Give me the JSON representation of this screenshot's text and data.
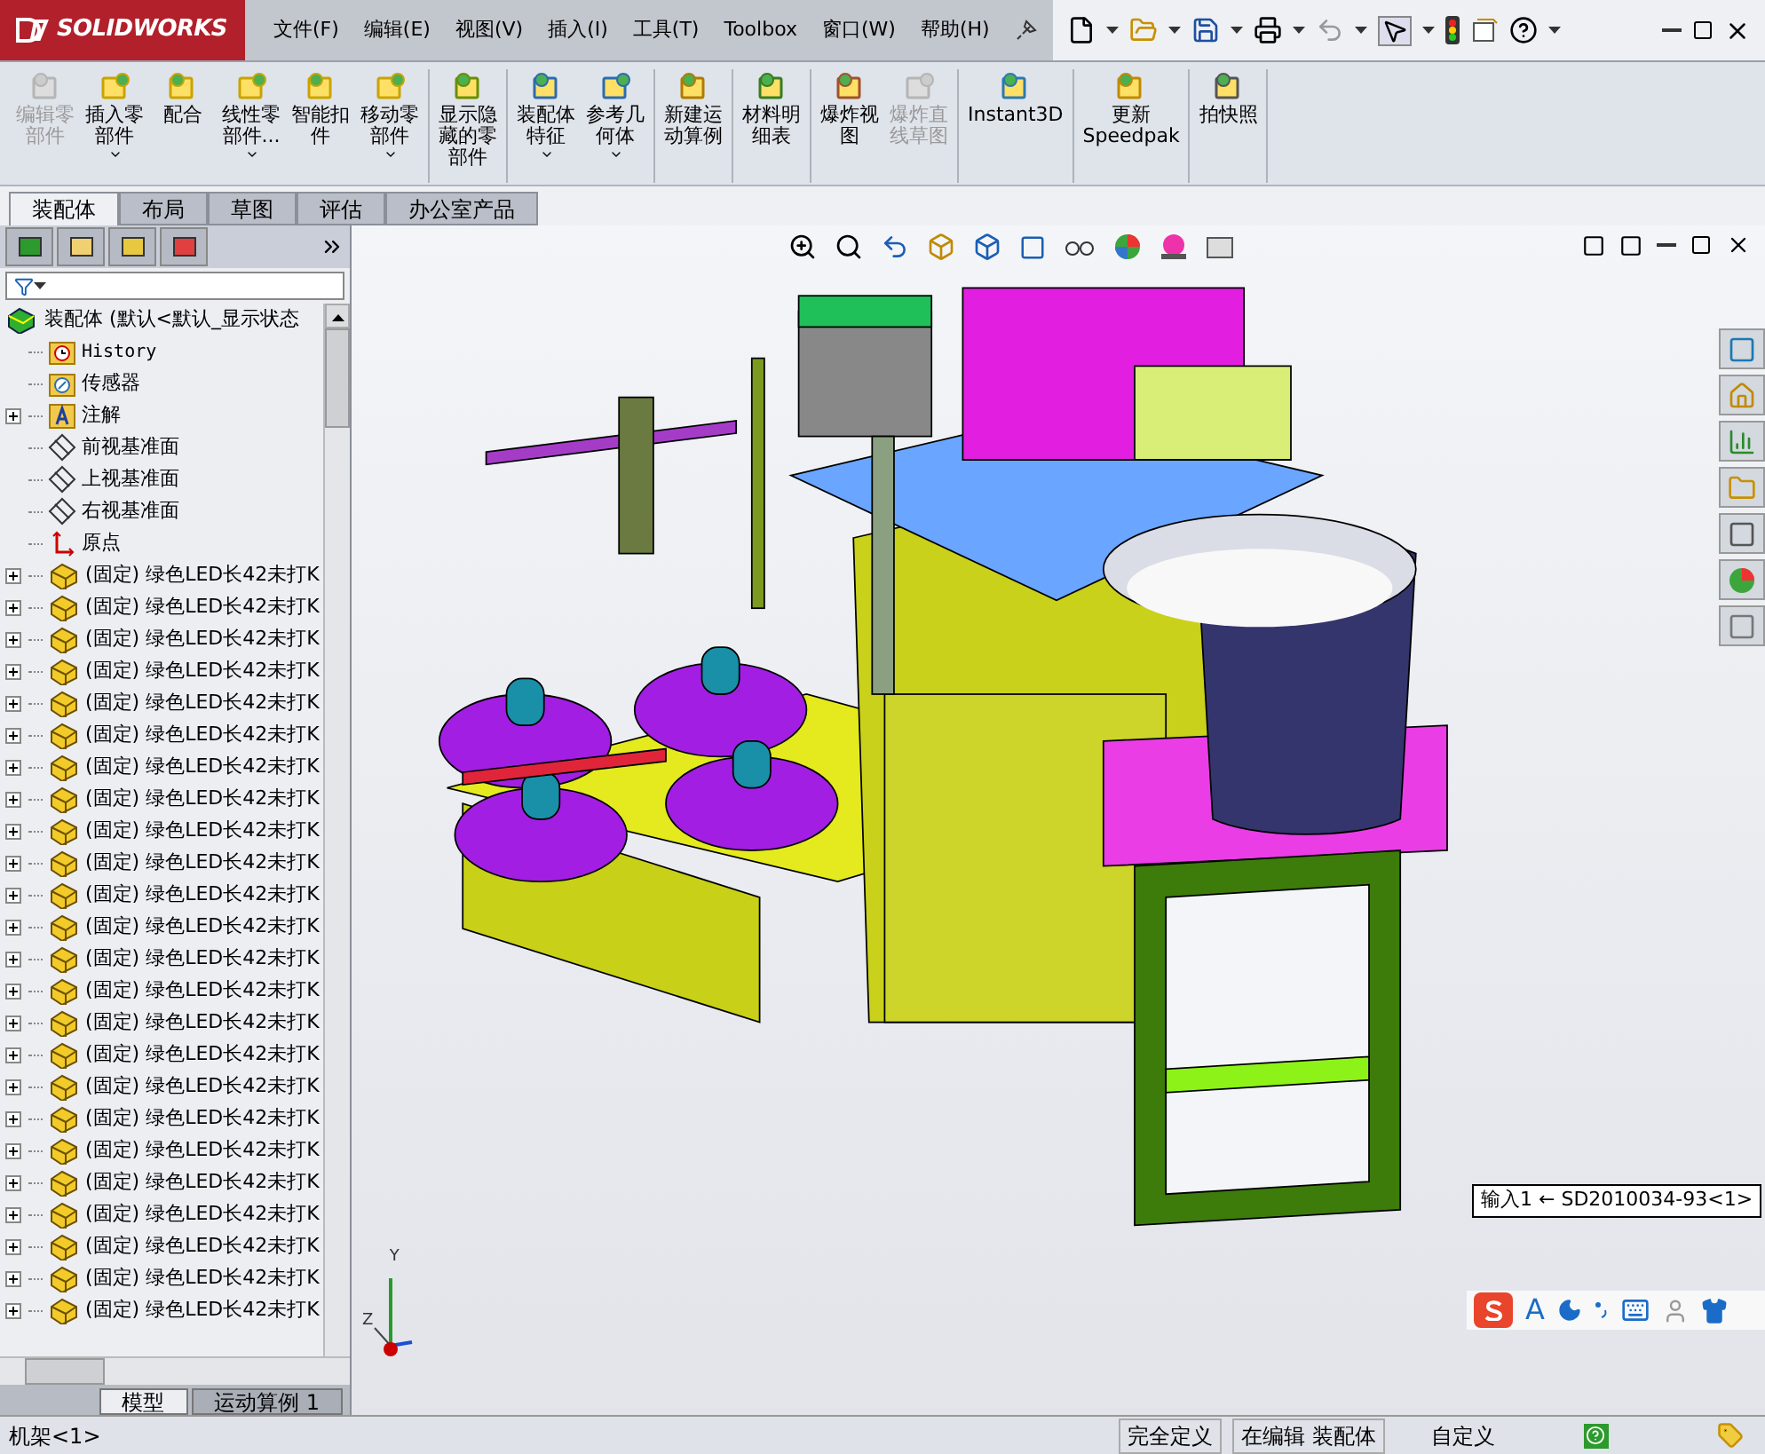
{
  "app": {
    "logo_text": "SOLIDWORKS"
  },
  "menu": [
    "文件(F)",
    "编辑(E)",
    "视图(V)",
    "插入(I)",
    "工具(T)",
    "Toolbox",
    "窗口(W)",
    "帮助(H)"
  ],
  "ribbon": {
    "groups": [
      [
        {
          "lines": [
            "编辑零",
            "部件"
          ],
          "disabled": true,
          "dropdown": false
        },
        {
          "lines": [
            "插入零",
            "部件"
          ],
          "disabled": false,
          "dropdown": true
        },
        {
          "lines": [
            "配合"
          ],
          "disabled": false,
          "dropdown": false
        },
        {
          "lines": [
            "线性零",
            "部件..."
          ],
          "disabled": false,
          "dropdown": true
        },
        {
          "lines": [
            "智能扣",
            "件"
          ],
          "disabled": false,
          "dropdown": false
        },
        {
          "lines": [
            "移动零",
            "部件"
          ],
          "disabled": false,
          "dropdown": true
        }
      ],
      [
        {
          "lines": [
            "显示隐",
            "藏的零",
            "部件"
          ],
          "disabled": false,
          "dropdown": false
        }
      ],
      [
        {
          "lines": [
            "装配体",
            "特征"
          ],
          "disabled": false,
          "dropdown": true
        },
        {
          "lines": [
            "参考几",
            "何体"
          ],
          "disabled": false,
          "dropdown": true
        }
      ],
      [
        {
          "lines": [
            "新建运",
            "动算例"
          ],
          "disabled": false,
          "dropdown": false
        }
      ],
      [
        {
          "lines": [
            "材料明",
            "细表"
          ],
          "disabled": false,
          "dropdown": false
        }
      ],
      [
        {
          "lines": [
            "爆炸视",
            "图"
          ],
          "disabled": false,
          "dropdown": false
        },
        {
          "lines": [
            "爆炸直",
            "线草图"
          ],
          "disabled": true,
          "dropdown": false
        }
      ],
      [
        {
          "lines": [
            "Instant3D"
          ],
          "disabled": false,
          "dropdown": false
        }
      ],
      [
        {
          "lines": [
            "更新",
            "Speedpak"
          ],
          "disabled": false,
          "dropdown": false
        }
      ],
      [
        {
          "lines": [
            "拍快照"
          ],
          "disabled": false,
          "dropdown": false
        }
      ]
    ]
  },
  "tabs": [
    {
      "label": "装配体",
      "selected": true
    },
    {
      "label": "布局",
      "selected": false
    },
    {
      "label": "草图",
      "selected": false
    },
    {
      "label": "评估",
      "selected": false
    },
    {
      "label": "办公室产品",
      "selected": false
    }
  ],
  "tree": {
    "root": "装配体 (默认<默认_显示状态",
    "items": [
      {
        "label": "History",
        "kind": "history",
        "expandable": false
      },
      {
        "label": "传感器",
        "kind": "sensor",
        "expandable": false
      },
      {
        "label": "注解",
        "kind": "annotation",
        "expandable": true
      },
      {
        "label": "前视基准面",
        "kind": "plane",
        "expandable": false
      },
      {
        "label": "上视基准面",
        "kind": "plane",
        "expandable": false
      },
      {
        "label": "右视基准面",
        "kind": "plane",
        "expandable": false
      },
      {
        "label": "原点",
        "kind": "origin",
        "expandable": false
      },
      {
        "label": "(固定) 绿色LED长42未打K",
        "kind": "part",
        "expandable": true
      },
      {
        "label": "(固定) 绿色LED长42未打K",
        "kind": "part",
        "expandable": true
      },
      {
        "label": "(固定) 绿色LED长42未打K",
        "kind": "part",
        "expandable": true
      },
      {
        "label": "(固定) 绿色LED长42未打K",
        "kind": "part",
        "expandable": true
      },
      {
        "label": "(固定) 绿色LED长42未打K",
        "kind": "part",
        "expandable": true
      },
      {
        "label": "(固定) 绿色LED长42未打K",
        "kind": "part",
        "expandable": true
      },
      {
        "label": "(固定) 绿色LED长42未打K",
        "kind": "part",
        "expandable": true
      },
      {
        "label": "(固定) 绿色LED长42未打K",
        "kind": "part",
        "expandable": true
      },
      {
        "label": "(固定) 绿色LED长42未打K",
        "kind": "part",
        "expandable": true
      },
      {
        "label": "(固定) 绿色LED长42未打K",
        "kind": "part",
        "expandable": true
      },
      {
        "label": "(固定) 绿色LED长42未打K",
        "kind": "part",
        "expandable": true
      },
      {
        "label": "(固定) 绿色LED长42未打K",
        "kind": "part",
        "expandable": true
      },
      {
        "label": "(固定) 绿色LED长42未打K",
        "kind": "part",
        "expandable": true
      },
      {
        "label": "(固定) 绿色LED长42未打K",
        "kind": "part",
        "expandable": true
      },
      {
        "label": "(固定) 绿色LED长42未打K",
        "kind": "part",
        "expandable": true
      },
      {
        "label": "(固定) 绿色LED长42未打K",
        "kind": "part",
        "expandable": true
      },
      {
        "label": "(固定) 绿色LED长42未打K",
        "kind": "part",
        "expandable": true
      },
      {
        "label": "(固定) 绿色LED长42未打K",
        "kind": "part",
        "expandable": true
      },
      {
        "label": "(固定) 绿色LED长42未打K",
        "kind": "part",
        "expandable": true
      },
      {
        "label": "(固定) 绿色LED长42未打K",
        "kind": "part",
        "expandable": true
      },
      {
        "label": "(固定) 绿色LED长42未打K",
        "kind": "part",
        "expandable": true
      },
      {
        "label": "(固定) 绿色LED长42未打K",
        "kind": "part",
        "expandable": true
      },
      {
        "label": "(固定) 绿色LED长42未打K",
        "kind": "part",
        "expandable": true
      },
      {
        "label": "(固定) 绿色LED长42未打K",
        "kind": "part",
        "expandable": true
      }
    ]
  },
  "bottom_tabs": [
    {
      "label": "模型",
      "selected": true
    },
    {
      "label": "运动算例 1",
      "selected": false
    }
  ],
  "viewport": {
    "tooltip": "输入1 ← SD2010034-93<1>",
    "triad": [
      "Y",
      "Z"
    ],
    "ime_mode": "A"
  },
  "status": {
    "component": "机架<1>",
    "fields": [
      "完全定义",
      "在编辑 装配体",
      "自定义"
    ]
  }
}
